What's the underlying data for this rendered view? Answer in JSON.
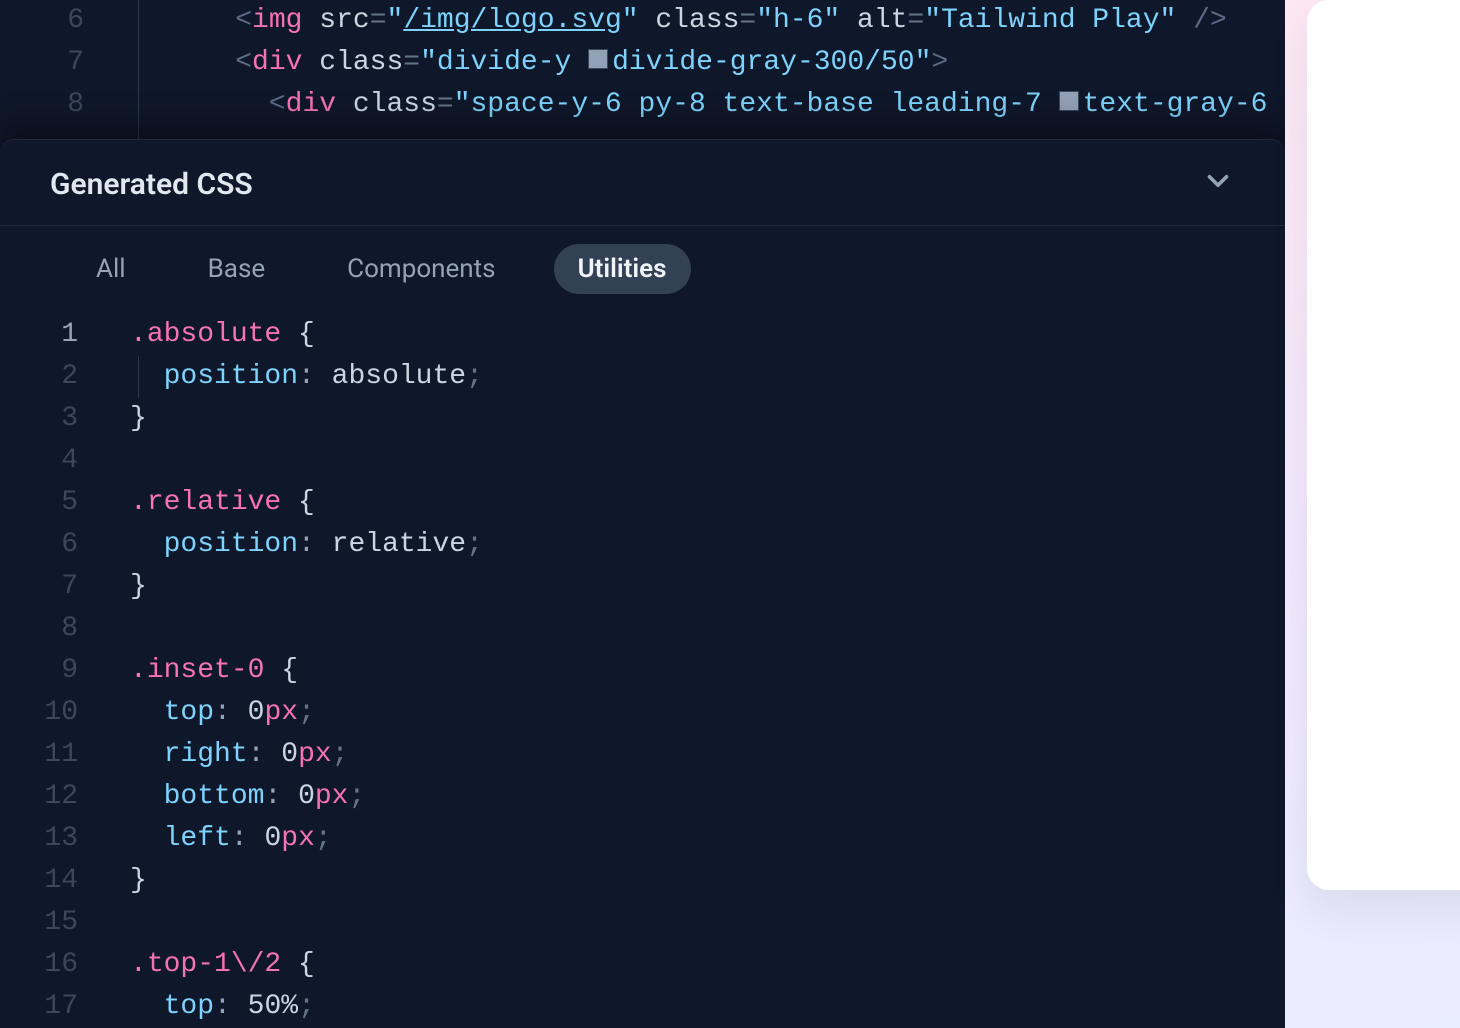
{
  "top_editor": {
    "line_numbers": [
      "6",
      "7",
      "8"
    ],
    "rows": [
      [
        {
          "t": "punc",
          "v": "<"
        },
        {
          "t": "tag",
          "v": "img"
        },
        {
          "t": "plain",
          "v": " "
        },
        {
          "t": "attr",
          "v": "src"
        },
        {
          "t": "eq",
          "v": "="
        },
        {
          "t": "str",
          "v": "\""
        },
        {
          "t": "strlnk",
          "v": "/img/logo.svg"
        },
        {
          "t": "str",
          "v": "\""
        },
        {
          "t": "plain",
          "v": " "
        },
        {
          "t": "attr",
          "v": "class"
        },
        {
          "t": "eq",
          "v": "="
        },
        {
          "t": "str",
          "v": "\"h-6\""
        },
        {
          "t": "plain",
          "v": " "
        },
        {
          "t": "attr",
          "v": "alt"
        },
        {
          "t": "eq",
          "v": "="
        },
        {
          "t": "str",
          "v": "\"Tailwind Play\""
        },
        {
          "t": "plain",
          "v": " "
        },
        {
          "t": "punc",
          "v": "/>"
        }
      ],
      [
        {
          "t": "punc",
          "v": "<"
        },
        {
          "t": "tag",
          "v": "div"
        },
        {
          "t": "plain",
          "v": " "
        },
        {
          "t": "attr",
          "v": "class"
        },
        {
          "t": "eq",
          "v": "="
        },
        {
          "t": "str",
          "v": "\"divide-y "
        },
        {
          "t": "swatch",
          "c": "sw-gray"
        },
        {
          "t": "str",
          "v": "divide-gray-300/50\""
        },
        {
          "t": "punc",
          "v": ">"
        }
      ],
      [
        {
          "t": "plain",
          "v": "  "
        },
        {
          "t": "punc",
          "v": "<"
        },
        {
          "t": "tag",
          "v": "div"
        },
        {
          "t": "plain",
          "v": " "
        },
        {
          "t": "attr",
          "v": "class"
        },
        {
          "t": "eq",
          "v": "="
        },
        {
          "t": "str",
          "v": "\"space-y-6 py-8 text-base leading-7 "
        },
        {
          "t": "swatch",
          "c": "sw-gray"
        },
        {
          "t": "str",
          "v": "text-gray-6"
        }
      ]
    ],
    "line6_indent": "    ",
    "line7_indent": "    ",
    "line8_indent": "    "
  },
  "panel": {
    "title": "Generated CSS",
    "tabs": [
      "All",
      "Base",
      "Components",
      "Utilities"
    ],
    "active_tab": 3
  },
  "css": {
    "line_numbers": [
      "1",
      "2",
      "3",
      "4",
      "5",
      "6",
      "7",
      "8",
      "9",
      "10",
      "11",
      "12",
      "13",
      "14",
      "15",
      "16",
      "17"
    ],
    "current_line_index": 0,
    "rows": [
      [
        {
          "t": "dot",
          "v": "."
        },
        {
          "t": "sel",
          "v": "absolute"
        },
        {
          "t": "plain",
          "v": " "
        },
        {
          "t": "br",
          "v": "{"
        }
      ],
      [
        {
          "t": "plain",
          "v": "  "
        },
        {
          "t": "prop",
          "v": "position"
        },
        {
          "t": "col",
          "v": ":"
        },
        {
          "t": "plain",
          "v": " "
        },
        {
          "t": "val",
          "v": "absolute"
        },
        {
          "t": "semi",
          "v": ";"
        }
      ],
      [
        {
          "t": "br",
          "v": "}"
        }
      ],
      [],
      [
        {
          "t": "dot",
          "v": "."
        },
        {
          "t": "sel",
          "v": "relative"
        },
        {
          "t": "plain",
          "v": " "
        },
        {
          "t": "br",
          "v": "{"
        }
      ],
      [
        {
          "t": "plain",
          "v": "  "
        },
        {
          "t": "prop",
          "v": "position"
        },
        {
          "t": "col",
          "v": ":"
        },
        {
          "t": "plain",
          "v": " "
        },
        {
          "t": "val",
          "v": "relative"
        },
        {
          "t": "semi",
          "v": ";"
        }
      ],
      [
        {
          "t": "br",
          "v": "}"
        }
      ],
      [],
      [
        {
          "t": "dot",
          "v": "."
        },
        {
          "t": "sel",
          "v": "inset-0"
        },
        {
          "t": "plain",
          "v": " "
        },
        {
          "t": "br",
          "v": "{"
        }
      ],
      [
        {
          "t": "plain",
          "v": "  "
        },
        {
          "t": "prop",
          "v": "top"
        },
        {
          "t": "col",
          "v": ":"
        },
        {
          "t": "plain",
          "v": " "
        },
        {
          "t": "val",
          "v": "0"
        },
        {
          "t": "unit",
          "v": "px"
        },
        {
          "t": "semi",
          "v": ";"
        }
      ],
      [
        {
          "t": "plain",
          "v": "  "
        },
        {
          "t": "prop",
          "v": "right"
        },
        {
          "t": "col",
          "v": ":"
        },
        {
          "t": "plain",
          "v": " "
        },
        {
          "t": "val",
          "v": "0"
        },
        {
          "t": "unit",
          "v": "px"
        },
        {
          "t": "semi",
          "v": ";"
        }
      ],
      [
        {
          "t": "plain",
          "v": "  "
        },
        {
          "t": "prop",
          "v": "bottom"
        },
        {
          "t": "col",
          "v": ":"
        },
        {
          "t": "plain",
          "v": " "
        },
        {
          "t": "val",
          "v": "0"
        },
        {
          "t": "unit",
          "v": "px"
        },
        {
          "t": "semi",
          "v": ";"
        }
      ],
      [
        {
          "t": "plain",
          "v": "  "
        },
        {
          "t": "prop",
          "v": "left"
        },
        {
          "t": "col",
          "v": ":"
        },
        {
          "t": "plain",
          "v": " "
        },
        {
          "t": "val",
          "v": "0"
        },
        {
          "t": "unit",
          "v": "px"
        },
        {
          "t": "semi",
          "v": ";"
        }
      ],
      [
        {
          "t": "br",
          "v": "}"
        }
      ],
      [],
      [
        {
          "t": "dot",
          "v": "."
        },
        {
          "t": "sel",
          "v": "top-1\\/2"
        },
        {
          "t": "plain",
          "v": " "
        },
        {
          "t": "br",
          "v": "{"
        }
      ],
      [
        {
          "t": "plain",
          "v": "  "
        },
        {
          "t": "prop",
          "v": "top"
        },
        {
          "t": "col",
          "v": ":"
        },
        {
          "t": "plain",
          "v": " "
        },
        {
          "t": "val",
          "v": "50%"
        },
        {
          "t": "semi",
          "v": ";"
        }
      ]
    ]
  }
}
